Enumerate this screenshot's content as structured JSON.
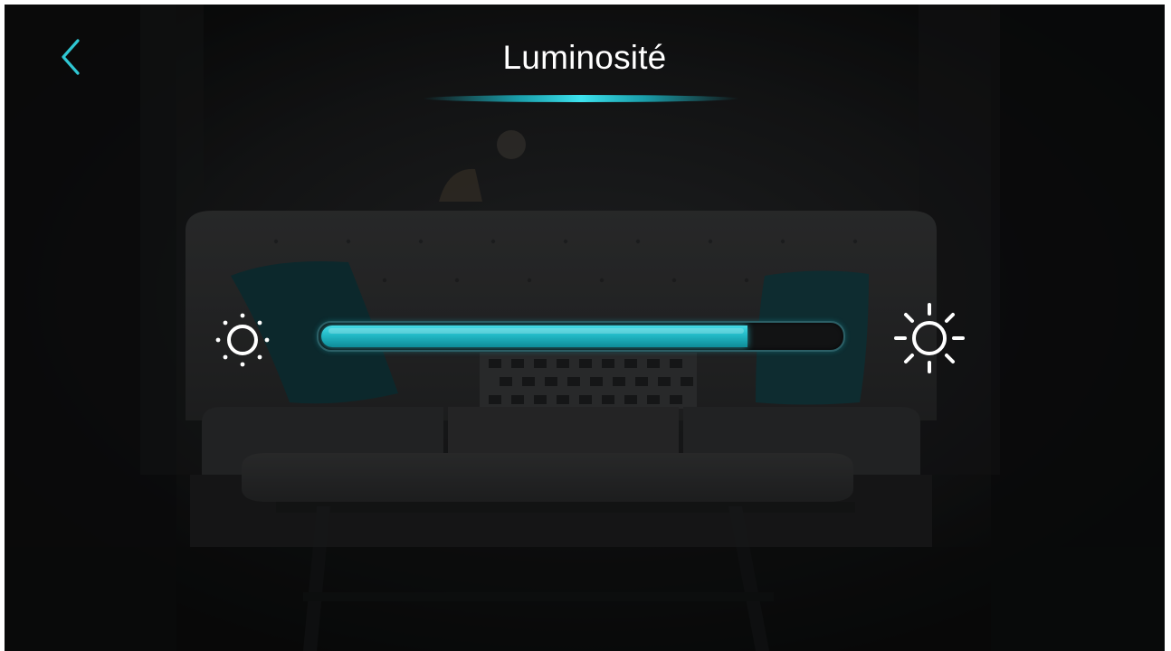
{
  "header": {
    "title": "Luminosité",
    "back_icon": "chevron-left-icon"
  },
  "brightness": {
    "level": 0.82,
    "low_icon": "sun-dim-icon",
    "high_icon": "sun-bright-icon"
  },
  "colors": {
    "accent": "#2fc7d3",
    "background": "#0c0d0e",
    "text": "#ffffff"
  }
}
